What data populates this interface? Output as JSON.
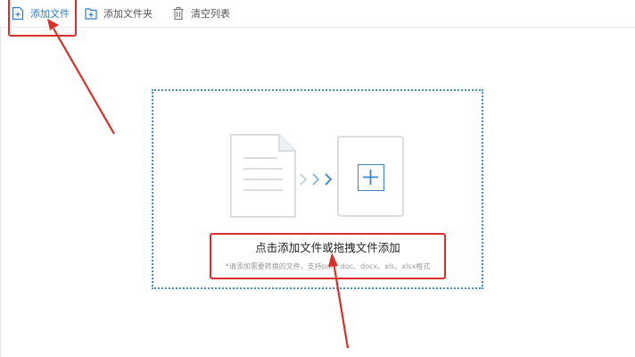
{
  "toolbar": {
    "items": [
      {
        "label": "添加文件",
        "icon": "add-file-icon"
      },
      {
        "label": "添加文件夹",
        "icon": "add-folder-icon"
      },
      {
        "label": "清空列表",
        "icon": "trash-icon"
      }
    ]
  },
  "dropzone": {
    "main_text": "点击添加文件或拖拽文件添加",
    "hint_text": "*请添加需要转换的文件，支持pdf、doc、docx、xls、xlsx格式",
    "icons": [
      "document-icon",
      "arrows-right-icon",
      "add-icon"
    ]
  },
  "colors": {
    "accent": "#2f7cc2",
    "annotation": "#d6312a",
    "dropzone_border": "#4a8ec9",
    "illustration_gray": "#dadde2"
  }
}
